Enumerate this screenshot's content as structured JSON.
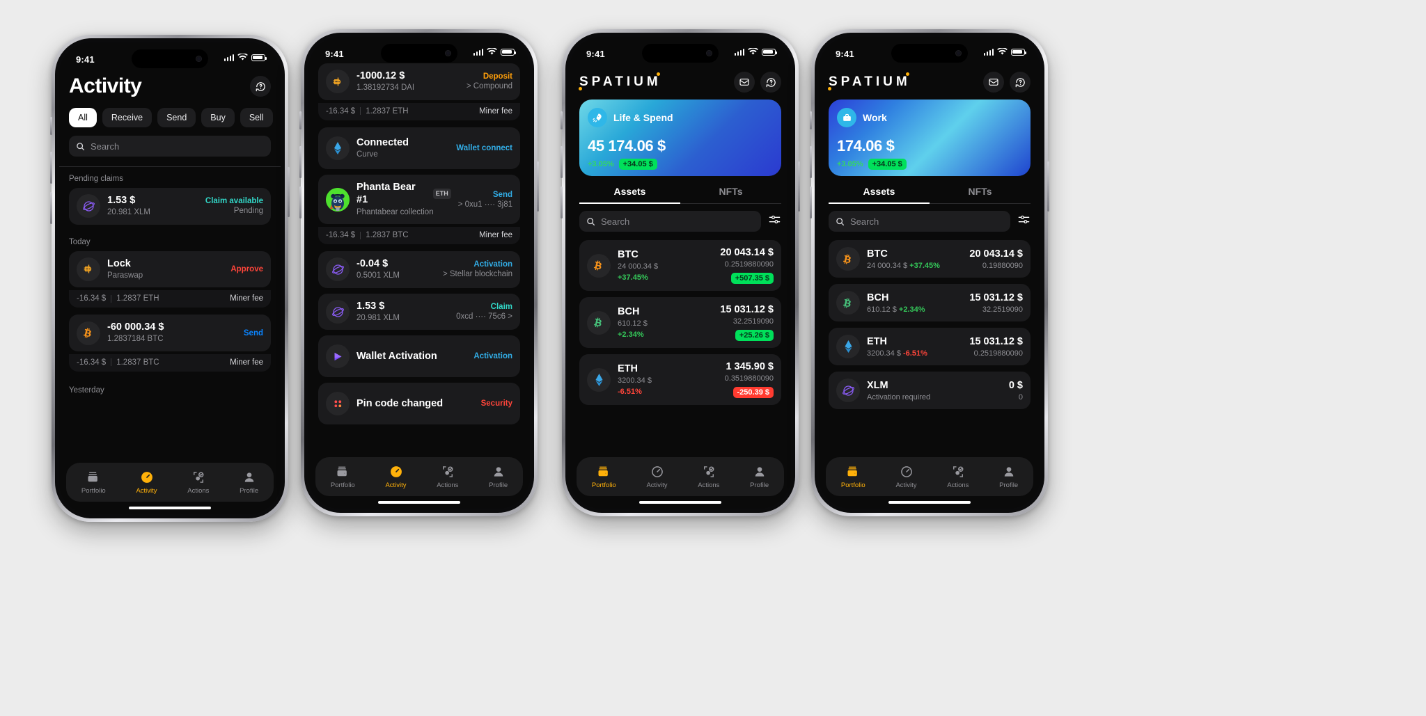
{
  "statusbar": {
    "time": "9:41"
  },
  "colors": {
    "accent_orange": "#ffb10a",
    "green": "#34c759",
    "red": "#ff453a",
    "blue": "#0a84ff",
    "cyan": "#32d8c8",
    "sky": "#32ade6",
    "badge_green_bg": "#00e05a",
    "badge_red_bg": "#ff3b30",
    "card_bg": "#1b1b1d",
    "screen_bg": "#0a0a0a"
  },
  "phone1": {
    "title": "Activity",
    "help_icon": "help-circle-icon",
    "chips": [
      {
        "label": "All",
        "active": true
      },
      {
        "label": "Receive",
        "active": false
      },
      {
        "label": "Send",
        "active": false
      },
      {
        "label": "Buy",
        "active": false
      },
      {
        "label": "Sell",
        "active": false
      }
    ],
    "search": {
      "placeholder": "Search",
      "icon": "search-icon"
    },
    "sections": [
      {
        "label": "Pending claims",
        "items": [
          {
            "icon": "xlm-icon",
            "title": "1.53 $",
            "subtitle": "20.981 XLM",
            "tag": "Claim available",
            "tag_color": "#32d8c8",
            "tag2": "Pending",
            "fee": null
          }
        ]
      },
      {
        "label": "Today",
        "items": [
          {
            "icon": "dai-icon",
            "title": "Lock",
            "subtitle": "Paraswap",
            "tag": "Approve",
            "tag_color": "#ff453a",
            "tag2": "",
            "fee": {
              "amount": "-16.34 $",
              "crypto": "1.2837 ETH",
              "label": "Miner fee"
            }
          },
          {
            "icon": "btc-icon",
            "title": "-60 000.34 $",
            "subtitle": "1.2837184 BTC",
            "tag": "Send",
            "tag_color": "#0a84ff",
            "tag2": "",
            "fee": {
              "amount": "-16.34 $",
              "crypto": "1.2837 BTC",
              "label": "Miner fee"
            }
          }
        ]
      },
      {
        "label": "Yesterday",
        "items": []
      }
    ],
    "tabbar": [
      {
        "label": "Portfolio",
        "icon": "wallet-icon",
        "active": false
      },
      {
        "label": "Activity",
        "icon": "activity-icon",
        "active": true
      },
      {
        "label": "Actions",
        "icon": "actions-icon",
        "active": false
      },
      {
        "label": "Profile",
        "icon": "profile-icon",
        "active": false
      }
    ]
  },
  "phone2": {
    "items": [
      {
        "icon": "dai-icon",
        "title": "-1000.12 $",
        "subtitle": "1.38192734 DAI",
        "tag": "Deposit",
        "tag_color": "#ff9f0a",
        "tag2": "> Compound",
        "fee": {
          "amount": "-16.34 $",
          "crypto": "1.2837 ETH",
          "label": "Miner fee"
        }
      },
      {
        "icon": "eth-icon",
        "title": "Connected",
        "subtitle": "Curve",
        "tag": "Wallet connect",
        "tag_color": "#32ade6",
        "tag2": "",
        "fee": null
      },
      {
        "icon": "nft-bear-icon",
        "title": "Phanta Bear #1",
        "title_badge": "ETH",
        "subtitle": "Phantabear collection",
        "tag": "Send",
        "tag_color": "#32ade6",
        "tag2": "> 0xu1 ···· 3j81",
        "fee": {
          "amount": "-16.34 $",
          "crypto": "1.2837 BTC",
          "label": "Miner fee"
        }
      },
      {
        "icon": "xlm-icon",
        "title": "-0.04 $",
        "subtitle": "0.5001 XLM",
        "tag": "Activation",
        "tag_color": "#32ade6",
        "tag2": "> Stellar blockchain",
        "fee": null
      },
      {
        "icon": "xlm-icon",
        "title": "1.53 $",
        "subtitle": "20.981 XLM",
        "tag": "Claim",
        "tag_color": "#32d8c8",
        "tag2": "0xcd ···· 75c6 >",
        "fee": null
      },
      {
        "icon": "wallet-activation-icon",
        "title": "Wallet Activation",
        "subtitle": "",
        "tag": "Activation",
        "tag_color": "#32ade6",
        "tag2": "",
        "fee": null
      },
      {
        "icon": "pincode-icon",
        "title": "Pin code changed",
        "subtitle": "",
        "tag": "Security",
        "tag_color": "#ff453a",
        "tag2": "",
        "fee": null
      }
    ],
    "tabbar": [
      {
        "label": "Portfolio",
        "icon": "wallet-icon",
        "active": false
      },
      {
        "label": "Activity",
        "icon": "activity-icon",
        "active": true
      },
      {
        "label": "Actions",
        "icon": "actions-icon",
        "active": false
      },
      {
        "label": "Profile",
        "icon": "profile-icon",
        "active": false
      }
    ]
  },
  "phone3": {
    "brand": "SPATIUM",
    "mail_icon": "mail-icon",
    "help_icon": "help-circle-icon",
    "balance": {
      "icon": "rocket-icon",
      "name": "Life & Spend",
      "amount": "45 174.06 $",
      "percent": "+3.05%",
      "delta": "+34.05 $"
    },
    "tabs": [
      {
        "label": "Assets",
        "active": true
      },
      {
        "label": "NFTs",
        "active": false
      }
    ],
    "search": {
      "placeholder": "Search",
      "icon": "search-icon"
    },
    "filter_icon": "sliders-icon",
    "assets": [
      {
        "icon": "btc-icon",
        "name": "BTC",
        "sub": "24 000.34 $",
        "change": "+37.45%",
        "change_color": "#34c759",
        "value": "20 043.14 $",
        "amount": "0.2519880090",
        "badge": "+507.35 $",
        "badge_type": "green"
      },
      {
        "icon": "bch-icon",
        "name": "BCH",
        "sub": "610.12 $",
        "change": "+2.34%",
        "change_color": "#34c759",
        "value": "15 031.12 $",
        "amount": "32.2519090",
        "badge": "+25.26 $",
        "badge_type": "green"
      },
      {
        "icon": "eth-icon",
        "name": "ETH",
        "sub": "3200.34 $",
        "change": "-6.51%",
        "change_color": "#ff453a",
        "value": "1 345.90 $",
        "amount": "0.3519880090",
        "badge": "-250.39 $",
        "badge_type": "red"
      }
    ],
    "tabbar": [
      {
        "label": "Portfolio",
        "icon": "wallet-icon",
        "active": true
      },
      {
        "label": "Activity",
        "icon": "activity-icon",
        "active": false
      },
      {
        "label": "Actions",
        "icon": "actions-icon",
        "active": false
      },
      {
        "label": "Profile",
        "icon": "profile-icon",
        "active": false
      }
    ]
  },
  "phone4": {
    "brand": "SPATIUM",
    "mail_icon": "mail-icon",
    "help_icon": "help-circle-icon",
    "balance": {
      "icon": "briefcase-icon",
      "name": "Work",
      "amount": "174.06 $",
      "percent": "+3.05%",
      "delta": "+34.05 $"
    },
    "tabs": [
      {
        "label": "Assets",
        "active": true
      },
      {
        "label": "NFTs",
        "active": false
      }
    ],
    "search": {
      "placeholder": "Search",
      "icon": "search-icon"
    },
    "filter_icon": "sliders-icon",
    "assets": [
      {
        "icon": "btc-icon",
        "name": "BTC",
        "sub": "24 000.34 $",
        "change": "+37.45%",
        "change_color": "#34c759",
        "value": "20 043.14 $",
        "amount": "0.19880090"
      },
      {
        "icon": "bch-icon",
        "name": "BCH",
        "sub": "610.12 $",
        "change": "+2.34%",
        "change_color": "#34c759",
        "value": "15 031.12 $",
        "amount": "32.2519090"
      },
      {
        "icon": "eth-icon",
        "name": "ETH",
        "sub": "3200.34 $",
        "change": "-6.51%",
        "change_color": "#ff453a",
        "value": "15 031.12 $",
        "amount": "0.2519880090"
      },
      {
        "icon": "xlm-icon",
        "name": "XLM",
        "sub": "Activation required",
        "change": "",
        "change_color": "#8e8e93",
        "value": "0 $",
        "amount": "0"
      }
    ],
    "tabbar": [
      {
        "label": "Portfolio",
        "icon": "wallet-icon",
        "active": true
      },
      {
        "label": "Activity",
        "icon": "activity-icon",
        "active": false
      },
      {
        "label": "Actions",
        "icon": "actions-icon",
        "active": false
      },
      {
        "label": "Profile",
        "icon": "profile-icon",
        "active": false
      }
    ]
  }
}
